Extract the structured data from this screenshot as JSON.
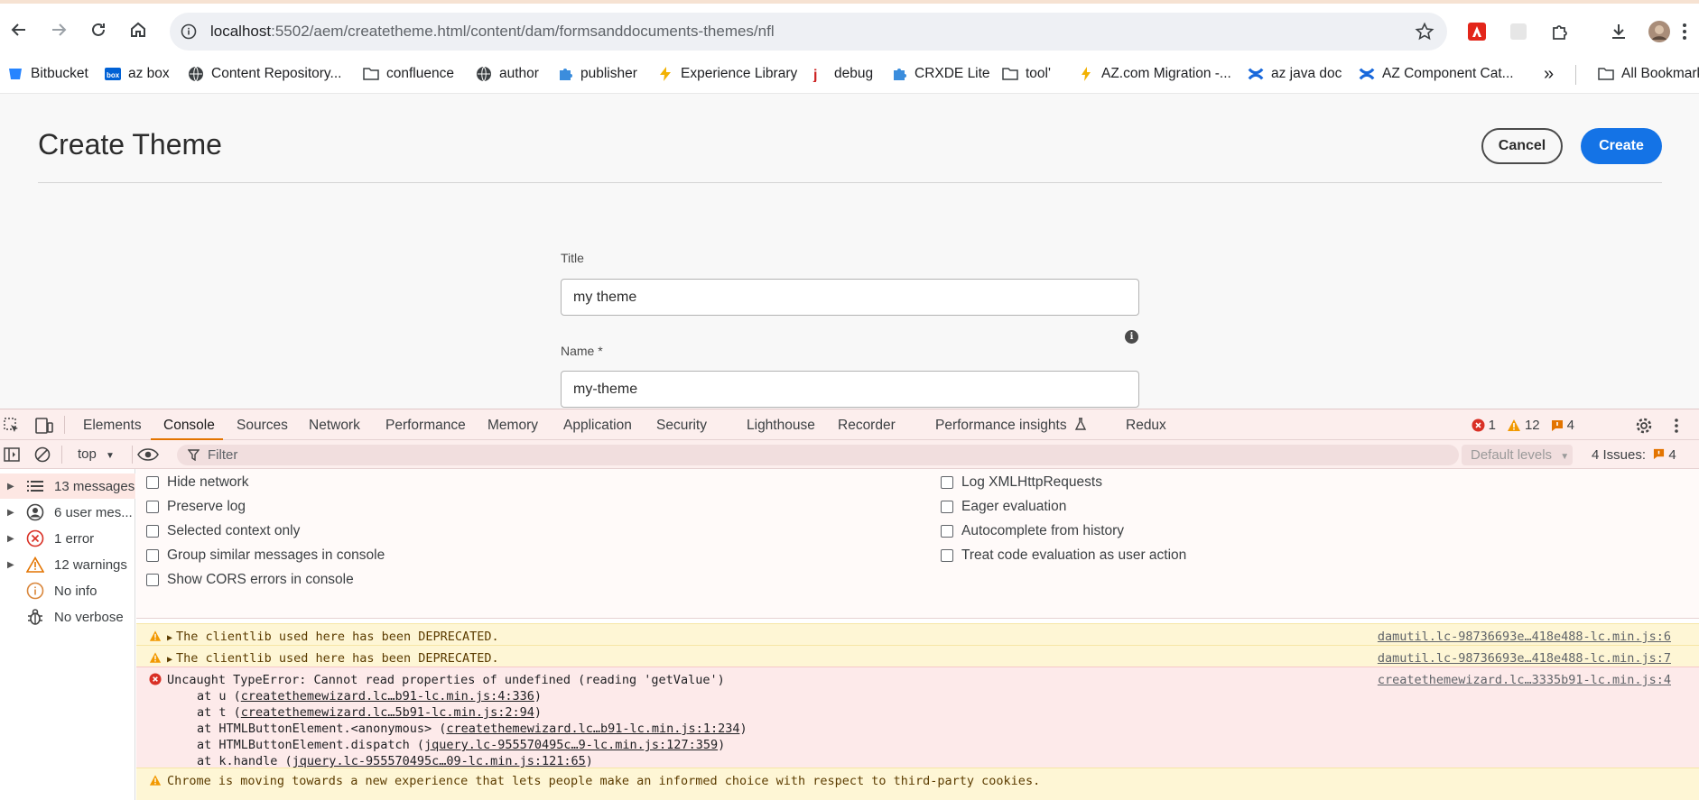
{
  "browser": {
    "url_host": "localhost",
    "url_rest": ":5502/aem/createtheme.html/content/dam/formsanddocuments-themes/nfl"
  },
  "bookmarks": [
    {
      "label": "Bitbucket",
      "icon": "bitbucket-icon"
    },
    {
      "label": "az box",
      "icon": "box-icon"
    },
    {
      "label": "Content Repository...",
      "icon": "globe-icon"
    },
    {
      "label": "confluence",
      "icon": "folder-icon"
    },
    {
      "label": "author",
      "icon": "globe-icon"
    },
    {
      "label": "publisher",
      "icon": "puzzle-icon"
    },
    {
      "label": "Experience Library",
      "icon": "bolt-icon"
    },
    {
      "label": "debug",
      "icon": "j-icon"
    },
    {
      "label": "CRXDE Lite",
      "icon": "puzzle-icon"
    },
    {
      "label": "tool'",
      "icon": "folder-icon"
    },
    {
      "label": "AZ.com Migration -...",
      "icon": "bolt-icon"
    },
    {
      "label": "az java doc",
      "icon": "confluence-icon"
    },
    {
      "label": "AZ Component Cat...",
      "icon": "confluence-icon"
    }
  ],
  "bookmarks_more": "»",
  "bookmarks_all": "All Bookmarks",
  "page": {
    "title": "Create Theme",
    "cancel": "Cancel",
    "create": "Create",
    "title_label": "Title",
    "title_value": "my theme",
    "name_label": "Name *",
    "name_value": "my-theme"
  },
  "devtools": {
    "tabs": [
      "Elements",
      "Console",
      "Sources",
      "Network",
      "Performance",
      "Memory",
      "Application",
      "Security",
      "Lighthouse",
      "Recorder",
      "Performance insights",
      "Redux"
    ],
    "active_tab": "Console",
    "error_count": "1",
    "warning_count": "12",
    "issue_count": "4",
    "context": "top",
    "filter_placeholder": "Filter",
    "levels": "Default levels",
    "issues_label": "4 Issues:",
    "issues_num": "4",
    "sidebar": [
      {
        "label": "13 messages",
        "icon": "list-icon"
      },
      {
        "label": "6 user mes...",
        "icon": "user-icon"
      },
      {
        "label": "1 error",
        "icon": "error-icon"
      },
      {
        "label": "12 warnings",
        "icon": "warning-icon"
      },
      {
        "label": "No info",
        "icon": "info-icon"
      },
      {
        "label": "No verbose",
        "icon": "bug-icon"
      }
    ],
    "options_left": [
      "Hide network",
      "Preserve log",
      "Selected context only",
      "Group similar messages in console",
      "Show CORS errors in console"
    ],
    "options_right": [
      "Log XMLHttpRequests",
      "Eager evaluation",
      "Autocomplete from history",
      "Treat code evaluation as user action"
    ],
    "messages": {
      "warn1": "The clientlib used here has been DEPRECATED.",
      "warn1_src": "damutil.lc-98736693e…418e488-lc.min.js:6",
      "warn2": "The clientlib used here has been DEPRECATED.",
      "warn2_src": "damutil.lc-98736693e…418e488-lc.min.js:7",
      "error": "Uncaught TypeError: Cannot read properties of undefined (reading 'getValue')",
      "error_src": "createthemewizard.lc…3335b91-lc.min.js:4",
      "stack": [
        {
          "prefix": "at u (",
          "link": "createthemewizard.lc…b91-lc.min.js:4:336",
          "suffix": ")"
        },
        {
          "prefix": "at t (",
          "link": "createthemewizard.lc…5b91-lc.min.js:2:94",
          "suffix": ")"
        },
        {
          "prefix": "at HTMLButtonElement.<anonymous> (",
          "link": "createthemewizard.lc…b91-lc.min.js:1:234",
          "suffix": ")"
        },
        {
          "prefix": "at HTMLButtonElement.dispatch (",
          "link": "jquery.lc-955570495c…9-lc.min.js:127:359",
          "suffix": ")"
        },
        {
          "prefix": "at k.handle (",
          "link": "jquery.lc-955570495c…09-lc.min.js:121:65",
          "suffix": ")"
        }
      ],
      "warn3": "Chrome is moving towards a new experience that lets people make an informed choice with respect to third-party cookies."
    }
  },
  "colors": {
    "accent": "#1473e6",
    "error": "#d93025",
    "warning": "#f29900"
  }
}
